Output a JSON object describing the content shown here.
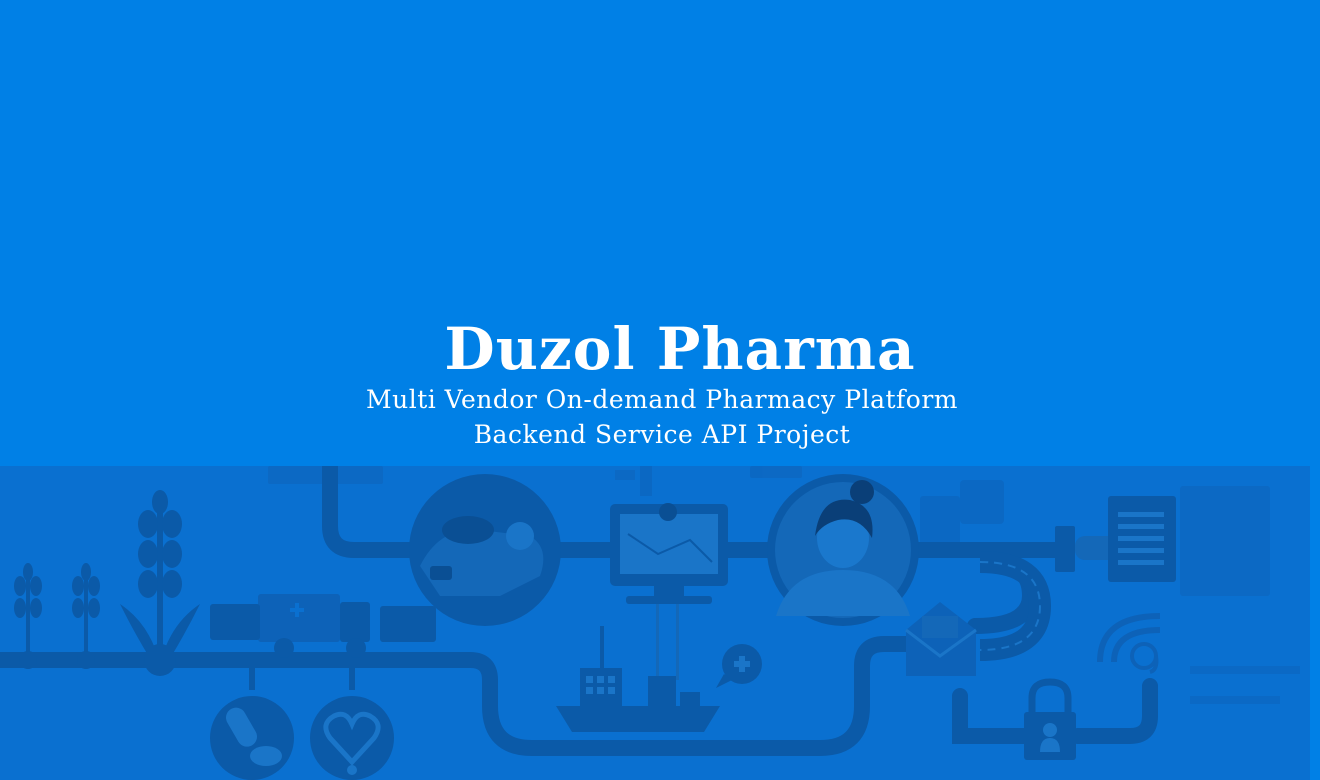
{
  "banner": {
    "title": "Duzol Pharma",
    "subtitle_line1": "Multi Vendor On-demand Pharmacy Platform",
    "subtitle_line2": "Backend Service API Project"
  },
  "colors": {
    "background": "#0080e6",
    "illustration_band": "#0a6fcf",
    "shape_dark": "#0b5aa8",
    "shape_mid": "#1468b8",
    "text": "#ffffff"
  },
  "icons": [
    "wheat-plant-icon",
    "truck-icon",
    "pill-icon",
    "heart-stethoscope-icon",
    "deliveryman-icon",
    "monitor-map-icon",
    "pharmacist-avatar-icon",
    "document-icon",
    "ship-icon",
    "medical-chat-bubble-icon",
    "envelope-icon",
    "padlock-user-icon",
    "at-sign-icon"
  ]
}
